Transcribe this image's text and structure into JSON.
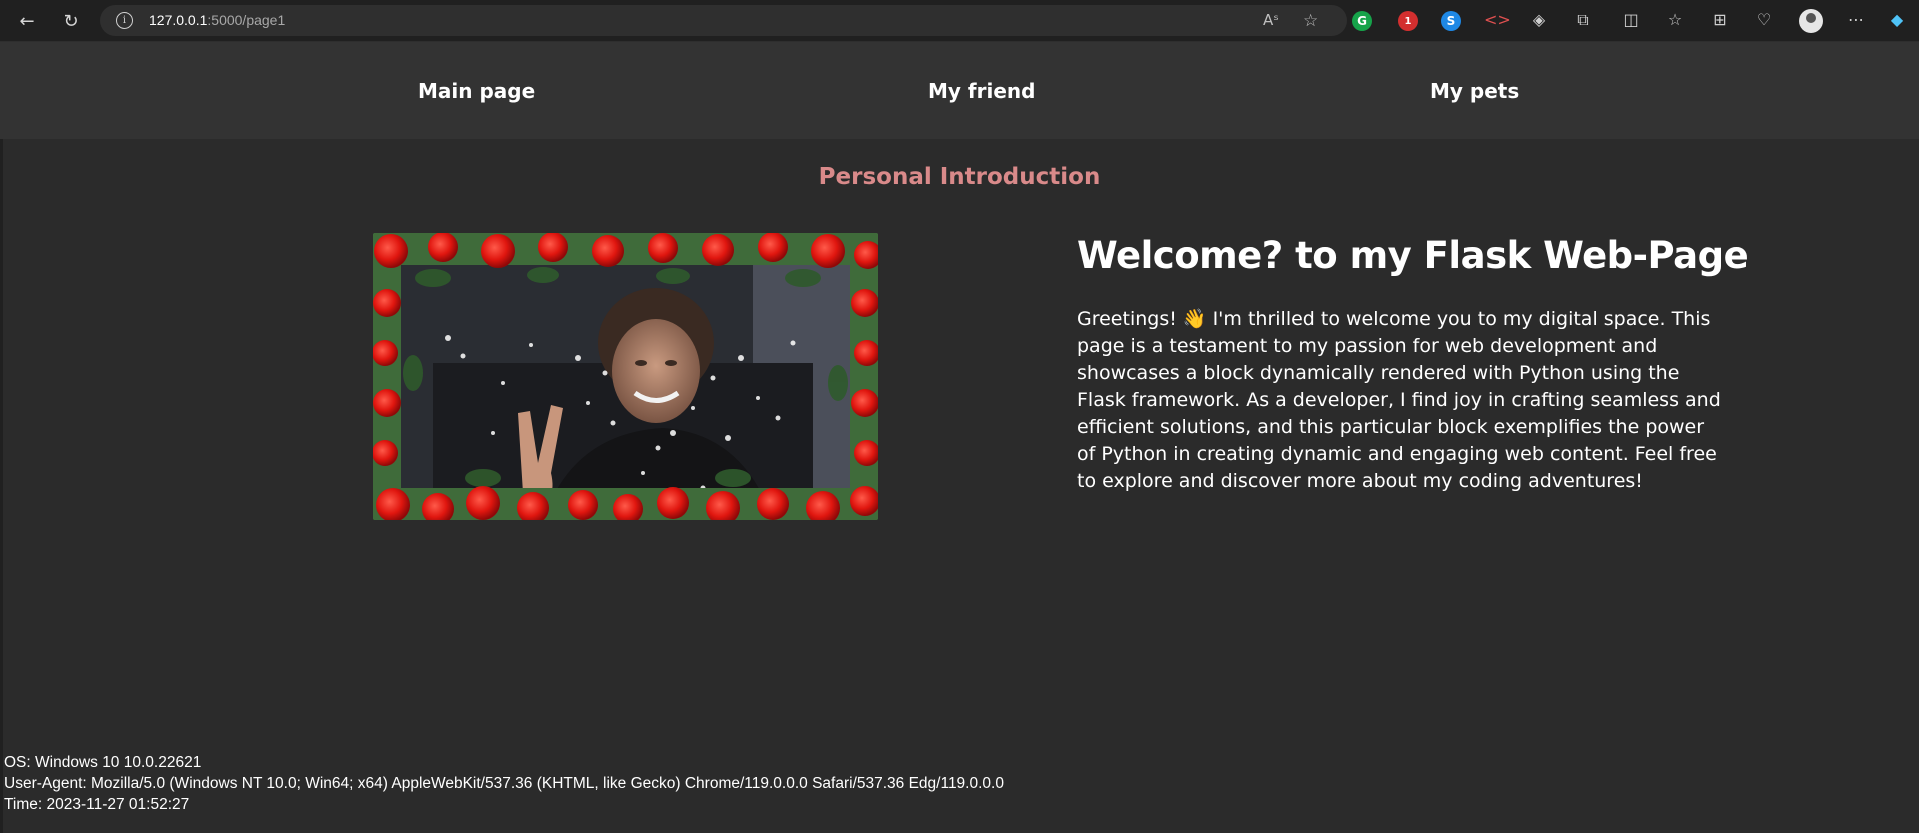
{
  "browser": {
    "url_host": "127.0.0.1",
    "url_path": ":5000/page1",
    "read_aloud_label": "Aˢ",
    "extension_badge": "1"
  },
  "navbar": {
    "links": [
      {
        "label": "Main page"
      },
      {
        "label": "My friend"
      },
      {
        "label": "My pets"
      }
    ]
  },
  "main": {
    "section_title": "Personal Introduction",
    "heading": "Welcome? to my Flask Web-Page",
    "intro": "Greetings! 👋 I'm thrilled to welcome you to my digital space. This page is a testament to my passion for web development and showcases a block dynamically rendered with Python using the Flask framework. As a developer, I find joy in crafting seamless and efficient solutions, and this particular block exemplifies the power of Python in creating dynamic and engaging web content. Feel free to explore and discover more about my coding adventures!"
  },
  "sysinfo": {
    "os": "OS: Windows 10 10.0.22621",
    "user_agent": "User-Agent: Mozilla/5.0 (Windows NT 10.0; Win64; x64) AppleWebKit/537.36 (KHTML, like Gecko) Chrome/119.0.0.0 Safari/537.36 Edg/119.0.0.0",
    "time": "Time: 2023-11-27 01:52:27"
  },
  "colors": {
    "page_bg": "#2b2b2b",
    "navbar_bg": "#333333",
    "section_title": "#d98a8a",
    "text": "#ffffff"
  },
  "icons": [
    "back-icon",
    "refresh-icon",
    "info-icon",
    "read-aloud-icon",
    "favorite-star-icon",
    "grammarly-icon",
    "adblock-icon",
    "shazam-icon",
    "devtools-icon",
    "extension-diamond-icon",
    "extensions-puzzle-icon",
    "split-screen-icon",
    "favorites-icon",
    "collections-icon",
    "browser-essentials-icon",
    "profile-avatar-icon",
    "more-menu-icon",
    "copilot-icon"
  ]
}
